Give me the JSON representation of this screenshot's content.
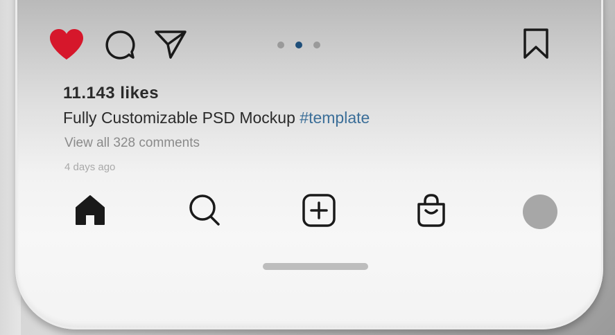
{
  "post": {
    "likes": "11.143 likes",
    "caption_text": "Fully Customizable PSD Mockup ",
    "caption_hashtag": "#template",
    "comments_link": "View all 328 comments",
    "timestamp": "4 days ago",
    "like_state": "liked",
    "carousel": {
      "count": 3,
      "active_index": 2
    }
  },
  "actions": {
    "icons": [
      "heart-icon",
      "comment-icon",
      "send-icon",
      "bookmark-icon"
    ]
  },
  "tabbar": {
    "icons": [
      "home-icon",
      "search-icon",
      "create-post-icon",
      "shop-bag-icon",
      "profile-avatar"
    ]
  },
  "colors": {
    "heart": "#d6172b",
    "hashtag": "#3b6e98",
    "active_dot": "#1f4f7a",
    "inactive_dot": "#9a9a9a",
    "avatar": "#a7a7a7",
    "text": "#2a2a2a"
  }
}
